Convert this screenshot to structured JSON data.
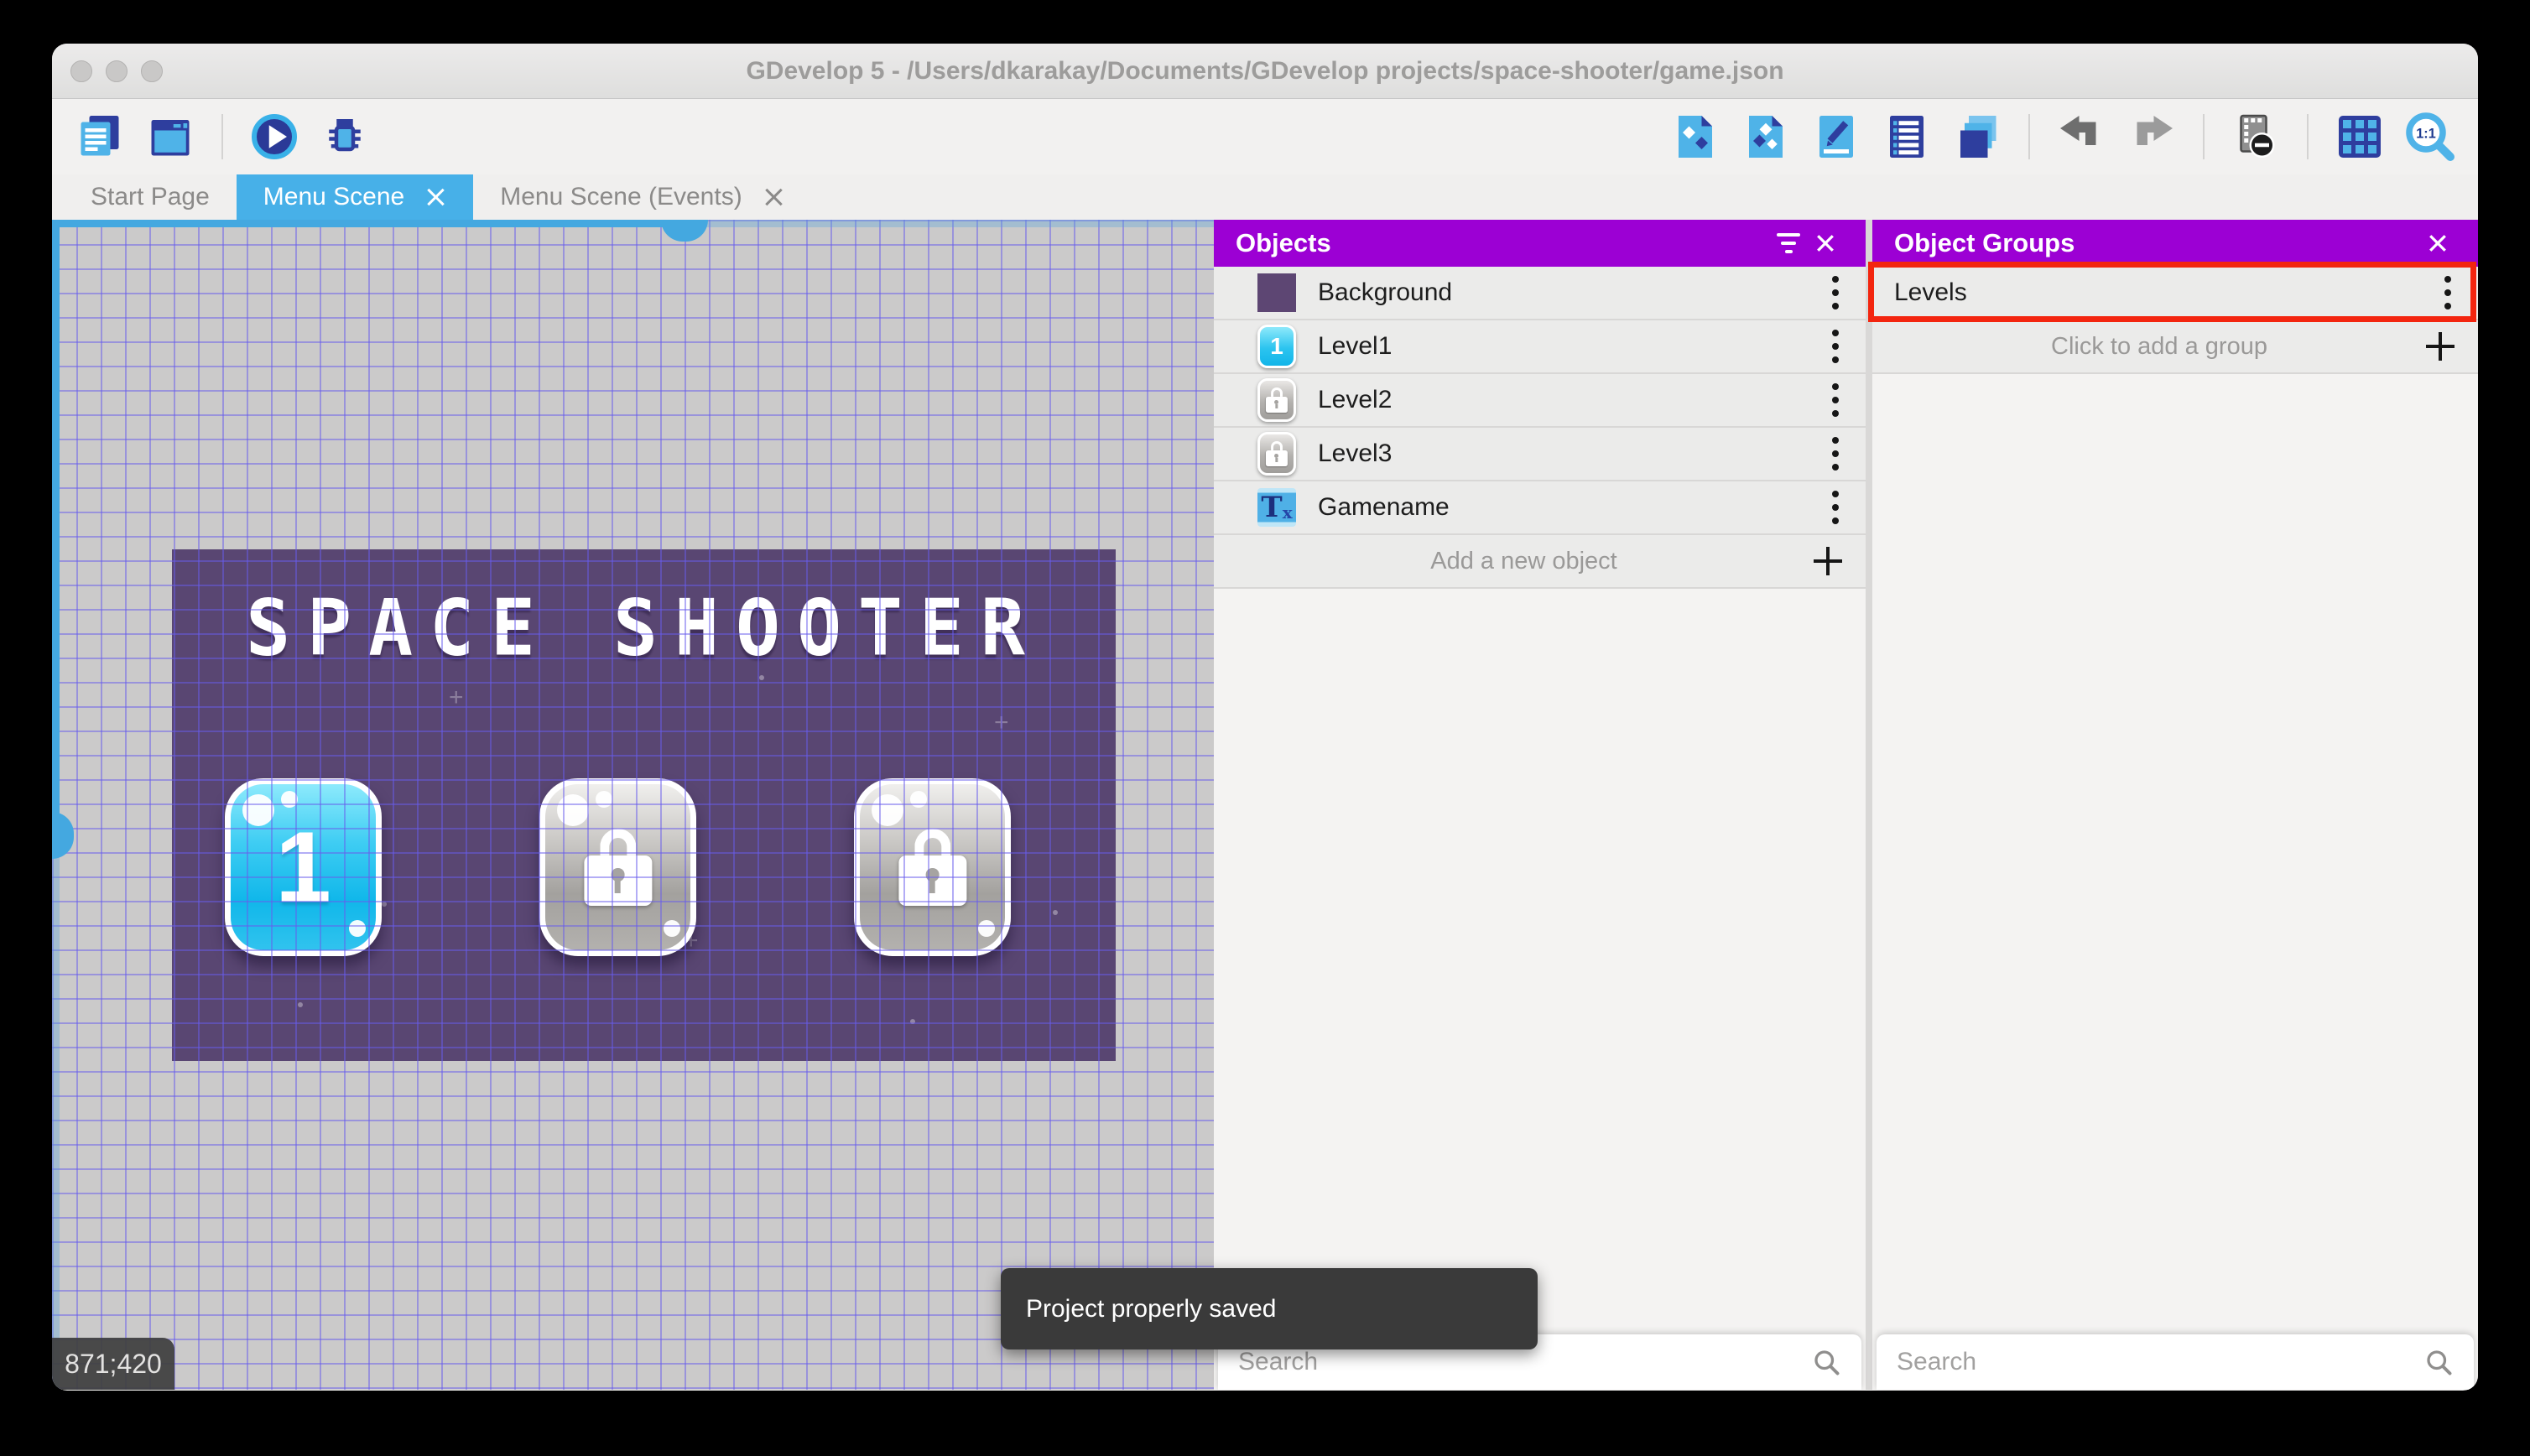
{
  "window": {
    "title": "GDevelop 5 - /Users/dkarakay/Documents/GDevelop projects/space-shooter/game.json"
  },
  "tabs": [
    {
      "label": "Start Page",
      "active": false,
      "closable": false
    },
    {
      "label": "Menu Scene",
      "active": true,
      "closable": true
    },
    {
      "label": "Menu Scene (Events)",
      "active": false,
      "closable": true
    }
  ],
  "toolbar": {
    "left_icons": [
      "project-manager",
      "scene-window",
      "play",
      "debug"
    ],
    "right_icons": [
      "objects-editor",
      "object-groups-editor",
      "properties",
      "instances-list",
      "layers",
      "undo",
      "redo",
      "render-mask",
      "grid",
      "zoom-1-1"
    ]
  },
  "icons": {
    "zoom_label": "1:1",
    "text_object_T": "T",
    "text_object_x": "x"
  },
  "canvas": {
    "game_title": "SPACE SHOOTER",
    "level1_label": "1",
    "coordinates": "871;420",
    "toast_message": "Project properly saved"
  },
  "objects_panel": {
    "title": "Objects",
    "items": [
      {
        "name": "Background",
        "icon": "purple-square"
      },
      {
        "name": "Level1",
        "icon": "blue-button",
        "icon_label": "1"
      },
      {
        "name": "Level2",
        "icon": "locked-button"
      },
      {
        "name": "Level3",
        "icon": "locked-button"
      },
      {
        "name": "Gamename",
        "icon": "text-object"
      }
    ],
    "add_label": "Add a new object",
    "search_placeholder": "Search"
  },
  "groups_panel": {
    "title": "Object Groups",
    "items": [
      {
        "name": "Levels",
        "highlighted": true
      }
    ],
    "add_label": "Click to add a group",
    "search_placeholder": "Search"
  },
  "colors": {
    "accent_purple": "#9c00d4",
    "tab_blue": "#47b0e8",
    "highlight_red": "#f3250f",
    "game_background": "#594672",
    "icon_navy": "#2e3e9e",
    "icon_blue": "#4fb3e8"
  }
}
